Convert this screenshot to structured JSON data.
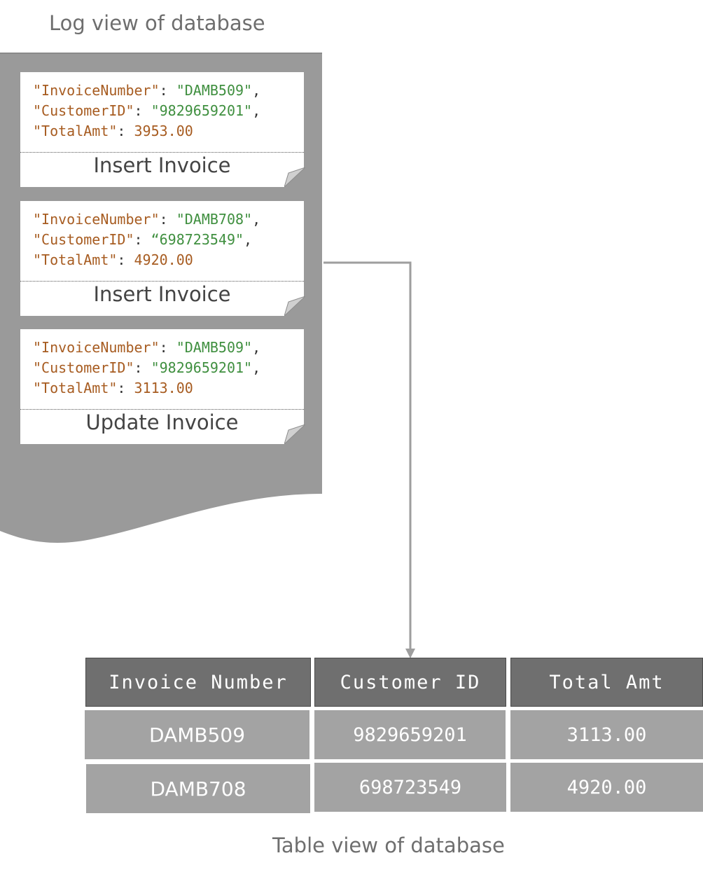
{
  "log_view": {
    "caption": "Log view of database",
    "entries": [
      {
        "invoice_key": "\"InvoiceNumber\"",
        "invoice_value": "\"DAMB509\"",
        "customer_key": "\"CustomerID\"",
        "customer_value": "\"9829659201\"",
        "total_key": "\"TotalAmt\"",
        "total_value": "3953.00",
        "operation": "Insert Invoice"
      },
      {
        "invoice_key": "\"InvoiceNumber\"",
        "invoice_value": "\"DAMB708\"",
        "customer_key": "\"CustomerID\"",
        "customer_value": "“698723549\"",
        "total_key": "\"TotalAmt\"",
        "total_value": "4920.00",
        "operation": "Insert Invoice"
      },
      {
        "invoice_key": "\"InvoiceNumber\"",
        "invoice_value": "\"DAMB509\"",
        "customer_key": "\"CustomerID\"",
        "customer_value": "\"9829659201\"",
        "total_key": "\"TotalAmt\"",
        "total_value": "3113.00",
        "operation": "Update Invoice"
      }
    ]
  },
  "table_view": {
    "caption": "Table view of database",
    "headers": [
      "Invoice Number",
      "Customer ID",
      "Total Amt"
    ],
    "rows": [
      [
        "DAMB509",
        "9829659201",
        "3113.00"
      ],
      [
        "DAMB708",
        "698723549",
        "4920.00"
      ]
    ]
  },
  "colors": {
    "log_background": "#9a9a9a",
    "json_key": "#a75c21",
    "json_string": "#3f8f3f",
    "table_header": "#6f6f6f",
    "table_cell": "#a3a3a3",
    "connector": "#9e9e9e"
  }
}
